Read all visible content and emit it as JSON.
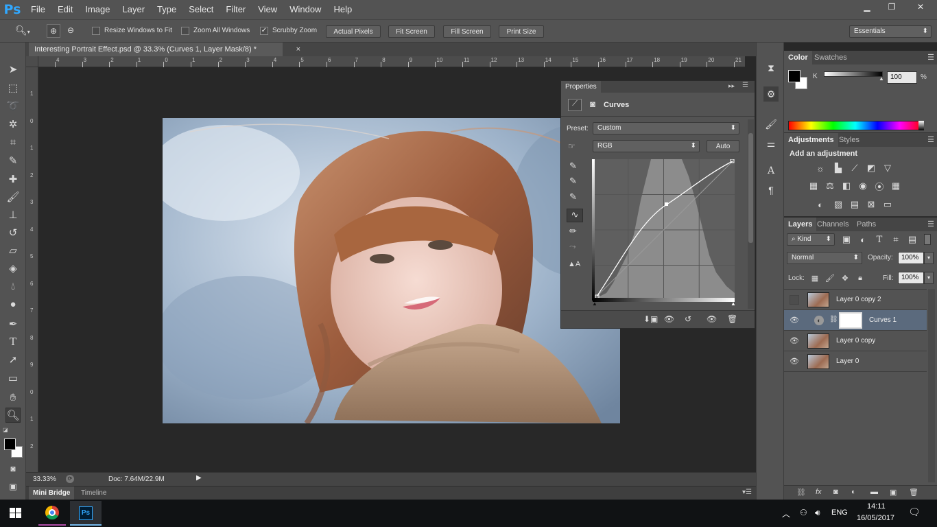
{
  "app": {
    "logo": "Ps"
  },
  "menu": [
    "File",
    "Edit",
    "Image",
    "Layer",
    "Type",
    "Select",
    "Filter",
    "View",
    "Window",
    "Help"
  ],
  "window_controls": {
    "minimize": "▁",
    "restore": "❐",
    "close": "✕"
  },
  "options": {
    "resize_windows": "Resize Windows to Fit",
    "zoom_all": "Zoom All Windows",
    "scrubby_zoom": "Scrubby Zoom",
    "actual_pixels": "Actual Pixels",
    "fit_screen": "Fit Screen",
    "fill_screen": "Fill Screen",
    "print_size": "Print Size",
    "workspace": "Essentials"
  },
  "document": {
    "tab_title": "Interesting Portrait Effect.psd @ 33.3% (Curves 1, Layer Mask/8) *",
    "close": "×",
    "zoom": "33.33%",
    "doc_info": "Doc: 7.64M/22.9M"
  },
  "ruler_top": [
    "4",
    "3",
    "2",
    "1",
    "0",
    "1",
    "2",
    "3",
    "4",
    "5",
    "6",
    "7",
    "8",
    "9",
    "10",
    "11",
    "12",
    "13",
    "14",
    "15",
    "16",
    "17",
    "18",
    "19",
    "20",
    "21"
  ],
  "ruler_left": [
    "1",
    "0",
    "1",
    "2",
    "3",
    "4",
    "5",
    "6",
    "7",
    "8",
    "9",
    "0",
    "1",
    "2"
  ],
  "bottom_tabs": {
    "mini_bridge": "Mini Bridge",
    "timeline": "Timeline"
  },
  "properties": {
    "tab": "Properties",
    "title": "Curves",
    "preset_label": "Preset:",
    "preset_value": "Custom",
    "channel": "RGB",
    "auto": "Auto"
  },
  "color_panel": {
    "tabs": [
      "Color",
      "Swatches"
    ],
    "channel": "K",
    "value": "100",
    "unit": "%"
  },
  "adjustments": {
    "tabs": [
      "Adjustments",
      "Styles"
    ],
    "title": "Add an adjustment"
  },
  "layers_panel": {
    "tabs": [
      "Layers",
      "Channels",
      "Paths"
    ],
    "kind": "Kind",
    "blend": "Normal",
    "opacity_label": "Opacity:",
    "opacity": "100%",
    "lock_label": "Lock:",
    "fill_label": "Fill:",
    "fill": "100%",
    "layers": [
      {
        "name": "Layer 0 copy 2",
        "visible": false
      },
      {
        "name": "Curves 1",
        "visible": true,
        "selected": true
      },
      {
        "name": "Layer 0 copy",
        "visible": true
      },
      {
        "name": "Layer 0",
        "visible": true
      }
    ]
  },
  "taskbar": {
    "language": "ENG",
    "time": "14:11",
    "date": "16/05/2017"
  },
  "colors": {
    "accent": "#31a8ff",
    "panel": "#535353",
    "canvas": "#282828"
  }
}
